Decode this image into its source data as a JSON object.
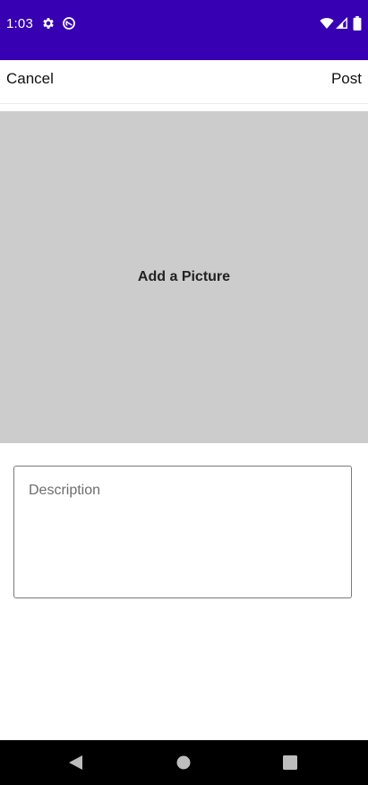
{
  "status_bar": {
    "time": "1:03",
    "background_color": "#3700B3",
    "icons": [
      "settings-icon",
      "sync-icon",
      "wifi-icon",
      "signal-icon",
      "battery-icon"
    ]
  },
  "top_bar": {
    "cancel_label": "Cancel",
    "post_label": "Post"
  },
  "picture_area": {
    "label": "Add a Picture",
    "background_color": "#cccccc"
  },
  "description": {
    "placeholder": "Description",
    "value": ""
  },
  "nav_bar": {
    "buttons": [
      "back-icon",
      "home-icon",
      "recents-icon"
    ]
  }
}
